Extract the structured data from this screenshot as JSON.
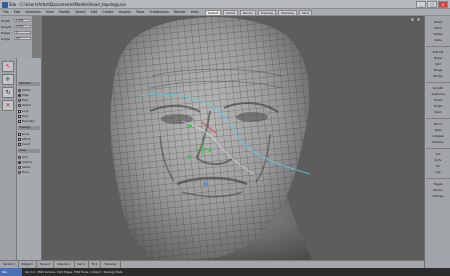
{
  "window": {
    "title": "Silo - C:\\Users\\Artist\\Documents\\Models\\head_topology.sia",
    "buttons": [
      "_",
      "□",
      "×"
    ]
  },
  "menubar": {
    "items": [
      "File",
      "Edit",
      "Selection",
      "View",
      "Modify",
      "Select",
      "Edit",
      "Create",
      "Display",
      "Tools",
      "Subdivision",
      "Render",
      "Help"
    ]
  },
  "top_tabs": [
    "Default",
    "Sculpt",
    "Render",
    "Topology",
    "Modeling",
    "Paint"
  ],
  "left_toolbar": {
    "rows": [
      {
        "label": "Width",
        "value": "1.000"
      },
      {
        "label": "Height",
        "value": "0.250"
      },
      {
        "label": "Edges",
        "value": "4"
      },
      {
        "label": "Angle",
        "value": "0.0"
      }
    ]
  },
  "tool_column": {
    "icons": [
      "select-icon",
      "move-icon",
      "rotate-icon",
      "scale-icon"
    ]
  },
  "left_panel": {
    "section_headers": [
      "Selection",
      "Topology",
      "Snap"
    ],
    "items": [
      {
        "label": "Vertex",
        "type": "radio",
        "on": false
      },
      {
        "label": "Edge",
        "type": "radio",
        "on": true
      },
      {
        "label": "Face",
        "type": "radio",
        "on": false
      },
      {
        "label": "Object",
        "type": "radio",
        "on": false
      },
      {
        "label": "Loop",
        "type": "check",
        "on": false
      },
      {
        "label": "Ring",
        "type": "check",
        "on": false
      },
      {
        "label": "Boundary",
        "type": "check",
        "on": false
      },
      {
        "label": "Grow",
        "type": "check",
        "on": false
      },
      {
        "label": "Shrink",
        "type": "check",
        "on": false
      },
      {
        "label": "Invert",
        "type": "check",
        "on": false
      },
      {
        "label": "Grid",
        "type": "radio",
        "on": false
      },
      {
        "label": "Surface",
        "type": "radio",
        "on": true
      },
      {
        "label": "Vertex",
        "type": "radio",
        "on": false
      },
      {
        "label": "None",
        "type": "radio",
        "on": false
      }
    ]
  },
  "right_panel": {
    "buttons": [
      "Select",
      "Move",
      "Rotate",
      "Scale",
      "Extrude",
      "Bevel",
      "Split",
      "Merge",
      "Bridge",
      "Smooth",
      "Subdivide",
      "Tweak",
      "Sculpt",
      "Paint",
      "Mirror",
      "Weld",
      "Collapse",
      "Dissolve",
      "Cut",
      "Knife",
      "Fill",
      "Cap",
      "Toggle",
      "Render",
      "Settings"
    ]
  },
  "status_bar": {
    "cells": [
      "Vertex 0",
      "Edges 0",
      "Faces 0",
      "Objects 1",
      "Sel 0",
      "Tri 0",
      "Topology"
    ]
  },
  "info_bar": {
    "mode": "Silo",
    "text": "Silo 2.0 - 3840 Vertices, 7422 Edges, 3584 Faces, 1 Object - Topology Mode"
  },
  "colors": {
    "mesh": "#9c9c9c",
    "wire": "#3a3a3a",
    "topology_curve": "#5ad0e8",
    "handle": "#3ec24a"
  }
}
